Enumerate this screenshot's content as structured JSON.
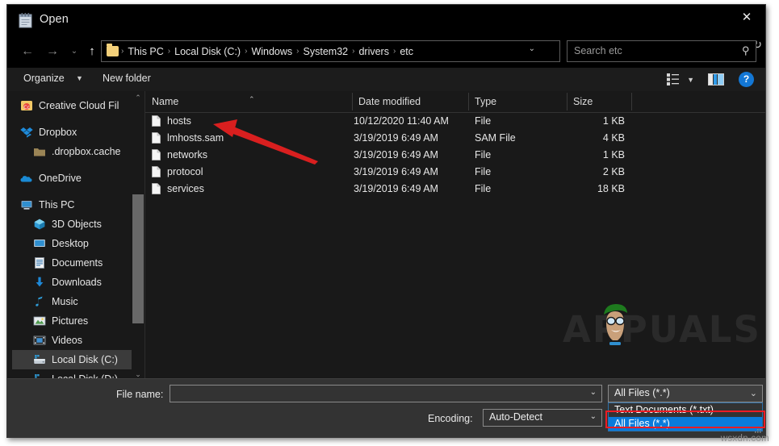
{
  "window": {
    "title": "Open",
    "app_icon": "notepad-icon",
    "close_label": "✕"
  },
  "nav": {
    "back_icon": "←",
    "forward_icon": "→",
    "recent_icon": "⌄",
    "up_icon": "↑",
    "refresh_icon": "↻",
    "address_caret": "⌄",
    "breadcrumbs": [
      "This PC",
      "Local Disk (C:)",
      "Windows",
      "System32",
      "drivers",
      "etc"
    ],
    "separator": "›"
  },
  "search": {
    "placeholder": "Search etc",
    "icon": "⚲"
  },
  "commandbar": {
    "organize_label": "Organize",
    "organize_caret": "▼",
    "new_folder_label": "New folder",
    "view_caret": "▼",
    "help_label": "?"
  },
  "sidebar": {
    "items": [
      {
        "label": "Creative Cloud Fil",
        "icon": "creative-cloud-icon",
        "indent": 0,
        "gap": false,
        "selected": false
      },
      {
        "label": "Dropbox",
        "icon": "dropbox-icon",
        "indent": 0,
        "gap": true,
        "selected": false
      },
      {
        "label": ".dropbox.cache",
        "icon": "folder-icon",
        "indent": 1,
        "gap": false,
        "selected": false
      },
      {
        "label": "OneDrive",
        "icon": "onedrive-icon",
        "indent": 0,
        "gap": true,
        "selected": false
      },
      {
        "label": "This PC",
        "icon": "this-pc-icon",
        "indent": 0,
        "gap": true,
        "selected": false
      },
      {
        "label": "3D Objects",
        "icon": "3d-objects-icon",
        "indent": 1,
        "gap": false,
        "selected": false
      },
      {
        "label": "Desktop",
        "icon": "desktop-icon",
        "indent": 1,
        "gap": false,
        "selected": false
      },
      {
        "label": "Documents",
        "icon": "documents-icon",
        "indent": 1,
        "gap": false,
        "selected": false
      },
      {
        "label": "Downloads",
        "icon": "downloads-icon",
        "indent": 1,
        "gap": false,
        "selected": false
      },
      {
        "label": "Music",
        "icon": "music-icon",
        "indent": 1,
        "gap": false,
        "selected": false
      },
      {
        "label": "Pictures",
        "icon": "pictures-icon",
        "indent": 1,
        "gap": false,
        "selected": false
      },
      {
        "label": "Videos",
        "icon": "videos-icon",
        "indent": 1,
        "gap": false,
        "selected": false
      },
      {
        "label": "Local Disk (C:)",
        "icon": "drive-icon",
        "indent": 1,
        "gap": false,
        "selected": true
      },
      {
        "label": "Local Disk (D:)",
        "icon": "drive-icon",
        "indent": 1,
        "gap": false,
        "selected": false
      }
    ],
    "scroll_up_icon": "⌃",
    "scroll_down_icon": "⌄"
  },
  "filelist": {
    "columns": [
      "Name",
      "Date modified",
      "Type",
      "Size"
    ],
    "sort_caret": "⌃",
    "rows": [
      {
        "name": "hosts",
        "date": "10/12/2020 11:40 AM",
        "type": "File",
        "size": "1 KB"
      },
      {
        "name": "lmhosts.sam",
        "date": "3/19/2019 6:49 AM",
        "type": "SAM File",
        "size": "4 KB"
      },
      {
        "name": "networks",
        "date": "3/19/2019 6:49 AM",
        "type": "File",
        "size": "1 KB"
      },
      {
        "name": "protocol",
        "date": "3/19/2019 6:49 AM",
        "type": "File",
        "size": "2 KB"
      },
      {
        "name": "services",
        "date": "3/19/2019 6:49 AM",
        "type": "File",
        "size": "18 KB"
      }
    ]
  },
  "bottom": {
    "filename_label": "File name:",
    "filename_value": "",
    "filename_caret": "⌄",
    "encoding_label": "Encoding:",
    "encoding_value": "Auto-Detect",
    "encoding_caret": "⌄",
    "filetype_value": "All Files  (*.*)",
    "filetype_caret": "⌄",
    "filetype_options": [
      "Text Documents (*.txt)",
      "All Files  (*.*)"
    ],
    "filetype_selected_index": 1
  },
  "annotations": {
    "arrow_color": "#d91f1f",
    "highlight_box_color": "#ec1c24",
    "selection_color": "#0a7bdb"
  },
  "watermarks": {
    "brand": "APPUALS",
    "site": "wsxdn.com"
  }
}
